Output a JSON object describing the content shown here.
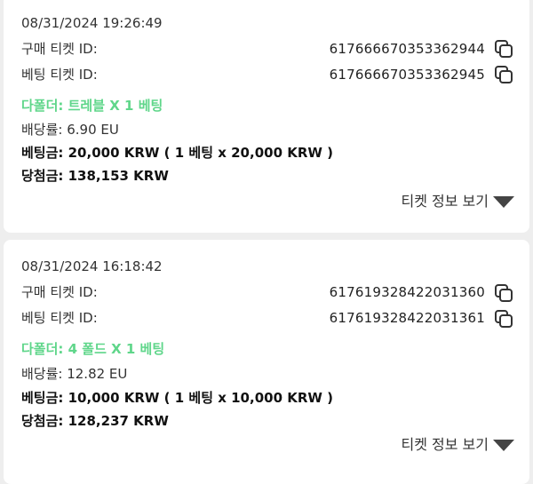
{
  "tickets": [
    {
      "datetime": "08/31/2024 19:26:49",
      "purchase_label": "구매 티켓 ID:",
      "purchase_id": "617666670353362944",
      "bet_label": "베팅 티켓 ID:",
      "bet_id": "617666670353362945",
      "bet_type": "다폴더: 트레블 X 1 베팅",
      "odds": "배당률: 6.90 EU",
      "stake": "베팅금: 20,000 KRW ( 1 베팅 x 20,000 KRW )",
      "winnings": "당첨금: 138,153 KRW",
      "toggle_label": "티켓 정보 보기"
    },
    {
      "datetime": "08/31/2024 16:18:42",
      "purchase_label": "구매 티켓 ID:",
      "purchase_id": "617619328422031360",
      "bet_label": "베팅 티켓 ID:",
      "bet_id": "617619328422031361",
      "bet_type": "다폴더: 4 폴드 X 1 베팅",
      "odds": "배당률: 12.82 EU",
      "stake": "베팅금: 10,000 KRW ( 1 베팅 x 10,000 KRW )",
      "winnings": "당첨금: 128,237 KRW",
      "toggle_label": "티켓 정보 보기"
    }
  ],
  "colors": {
    "accent_green": "#5fd68a",
    "background": "#eeeeee",
    "card": "#ffffff"
  },
  "icons": {
    "copy": "copy-icon",
    "expand": "caret-down-icon"
  }
}
